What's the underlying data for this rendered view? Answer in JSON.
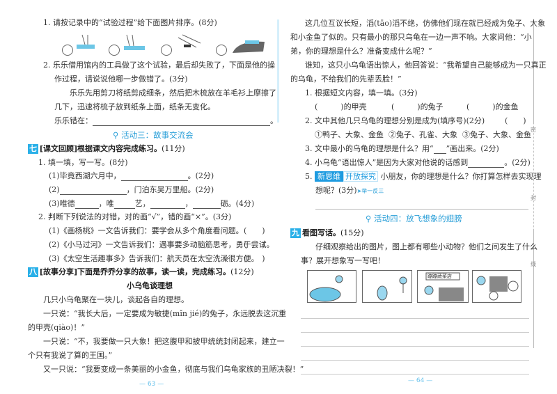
{
  "left_page": {
    "q1": "1. 请按记录中的“试验过程”给下面图片排序。(8分)",
    "q2_line1": "2. 乐乐借用馆内的工具做了这个试验，最后却失败了，下面是他的操",
    "q2_line2": "作过程，请说说他哪一步做错了。(3分)",
    "q2_text1": "乐乐先用剪刀将纸剪成细条，然后把木梳放在羊毛衫上摩擦了",
    "q2_text2": "几下，迅速将梳子放到纸条上面，纸条无变化。",
    "q2_answer_label": "乐乐错在：",
    "activity3": "活动三：故事交流会",
    "sec7_num": "七",
    "sec7_title": "[课文回顾]根据课文内容完成练习。",
    "sec7_score": "(11分)",
    "s7_q1": "1. 填一填，写一写。(8分)",
    "s7_q1_1a": "(1)毕竟西湖六月中，",
    "s7_q1_1b": "。(2分)",
    "s7_q1_2a": "(2)",
    "s7_q1_2b": "，门泊东吴万里船。(2分)",
    "s7_q1_3": [
      "(3)唯德",
      "，唯",
      "艺，",
      "，",
      "砺。(4分)"
    ],
    "s7_q2": "2. 判断下列说法的对错，对的画“√”，错的画“×”。(3分)",
    "s7_q2_items": [
      "(1)《画杨桃》一文告诉我们：要学会从多个角度看问题。",
      "(2)《小马过河》一文告诉我们：遇事要多动脑筋思考，勇于尝试。",
      "(3)《太空生活趣事多》告诉我们：航天员在太空洗澡很方便。"
    ],
    "paren": "(　　)",
    "sec8_num": "八",
    "sec8_title": "[故事分享]下面是乔乔分享的故事，读一读，完成练习。",
    "sec8_score": "(12分)",
    "story_title": "小乌龟谈理想",
    "story": [
      "几只小乌龟聚在一块儿，谈起各自的理想。",
      "一只说：“我长大后，一定要成为敏捷(mǐn jié)的兔子，永远脱去这沉重",
      "的甲壳(qiào)！”",
      "一只说：“不，我要做一只大象！把这腹甲和披甲统统封闭起来，建立一",
      "个只有我说了算的王国。”",
      "又一只说：“我要变成一条美丽的小金鱼，彻底与我们乌龟家族的丑陋决裂！”"
    ],
    "page_number": "63"
  },
  "right_page": {
    "story": [
      "这几位互议长短，滔(tāo)滔不绝，仿佛他们现在就已经成为兔子、大象",
      "和小金鱼了似的。只有最小的那只乌龟在一边一声不响。大家问他：“小",
      "弟，你的理想是什么？准备变成什么呢？”",
      "谁知，这只小乌龟语出惊人，他回答说：“我希望自己能够成为一只真正",
      "的乌龟，不给我们的先辈丢脸！”"
    ],
    "q1": "1. 根据短文内容，填一填。(3分)",
    "q1_blanks": [
      "(　　　)的甲壳",
      "(　　　)的兔子",
      "(　　　)的金鱼"
    ],
    "q2": "2. 文中其他几只乌龟的理想分别是成为(填序号)(2分)",
    "q2_paren": "(　　)",
    "q2_options": [
      "①鸭子、大象、金鱼",
      "②兔子、孔雀、大象",
      "③兔子、大象、金鱼"
    ],
    "q3a": "3. 文中最小的乌龟的理想是什么？用“",
    "q3b": "”画出来。(2分)",
    "q4a": "4. 小乌龟“语出惊人”是因为大家对他说的话感到",
    "q4b": "。(2分)",
    "q5_num": "5.",
    "q5_tag1": "新思维",
    "q5_tag2": "开放探究",
    "q5_text": "小朋友，你的理想是什么？你打算怎样去实现理",
    "q5_text2": "想呢？(3分)",
    "q5_link": "➤举一反三",
    "activity4": "活动四：放飞想象的翅膀",
    "sec9_num": "九",
    "sec9_title": "看图写话。",
    "sec9_score": "(15分)",
    "sec9_text1": "仔细观察给出的图片，图上都有哪些小动物？他们之间发生了什么",
    "sec9_text2": "事？展开想象写一写吧！",
    "shop_sign": "蹦蹦蔬菜店",
    "page_number": "64",
    "binding_marks": [
      "密",
      "封",
      "线"
    ]
  }
}
